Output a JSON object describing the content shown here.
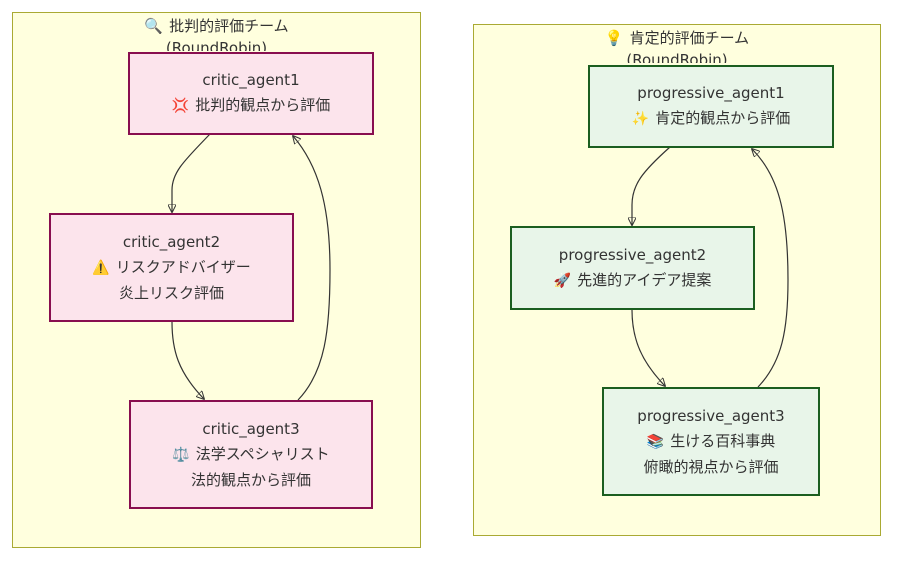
{
  "clusters": {
    "critic": {
      "icon": "magnifier-icon",
      "icon_glyph": "🔍",
      "title": "批判的評価チーム",
      "subtitle": "(RoundRobin)"
    },
    "positive": {
      "icon": "lightbulb-icon",
      "icon_glyph": "💡",
      "title": "肯定的評価チーム",
      "subtitle": "(RoundRobin)"
    }
  },
  "nodes": {
    "critic_agent1": {
      "name": "critic_agent1",
      "icon": "anger-symbol-icon",
      "icon_glyph": "💢",
      "line1": "批判的観点から評価"
    },
    "critic_agent2": {
      "name": "critic_agent2",
      "icon": "warning-icon",
      "icon_glyph": "⚠️",
      "line1": "リスクアドバイザー",
      "line2": "炎上リスク評価"
    },
    "critic_agent3": {
      "name": "critic_agent3",
      "icon": "scales-icon",
      "icon_glyph": "⚖️",
      "line1": "法学スペシャリスト",
      "line2": "法的観点から評価"
    },
    "progressive_agent1": {
      "name": "progressive_agent1",
      "icon": "sparkles-icon",
      "icon_glyph": "✨",
      "line1": "肯定的観点から評価"
    },
    "progressive_agent2": {
      "name": "progressive_agent2",
      "icon": "rocket-icon",
      "icon_glyph": "🚀",
      "line1": "先進的アイデア提案"
    },
    "progressive_agent3": {
      "name": "progressive_agent3",
      "icon": "books-icon",
      "icon_glyph": "📚",
      "line1": "生ける百科事典",
      "line2": "俯瞰的視点から評価"
    }
  },
  "edges": [
    {
      "from": "critic_agent1",
      "to": "critic_agent2"
    },
    {
      "from": "critic_agent2",
      "to": "critic_agent3"
    },
    {
      "from": "critic_agent3",
      "to": "critic_agent1"
    },
    {
      "from": "progressive_agent1",
      "to": "progressive_agent2"
    },
    {
      "from": "progressive_agent2",
      "to": "progressive_agent3"
    },
    {
      "from": "progressive_agent3",
      "to": "progressive_agent1"
    }
  ],
  "colors": {
    "cluster_fill": "#ffffde",
    "cluster_border": "#aaaa33",
    "critic_fill": "#fce4ec",
    "critic_border": "#880e4f",
    "progressive_fill": "#e8f5e9",
    "progressive_border": "#1b5e20",
    "edge": "#333333"
  }
}
